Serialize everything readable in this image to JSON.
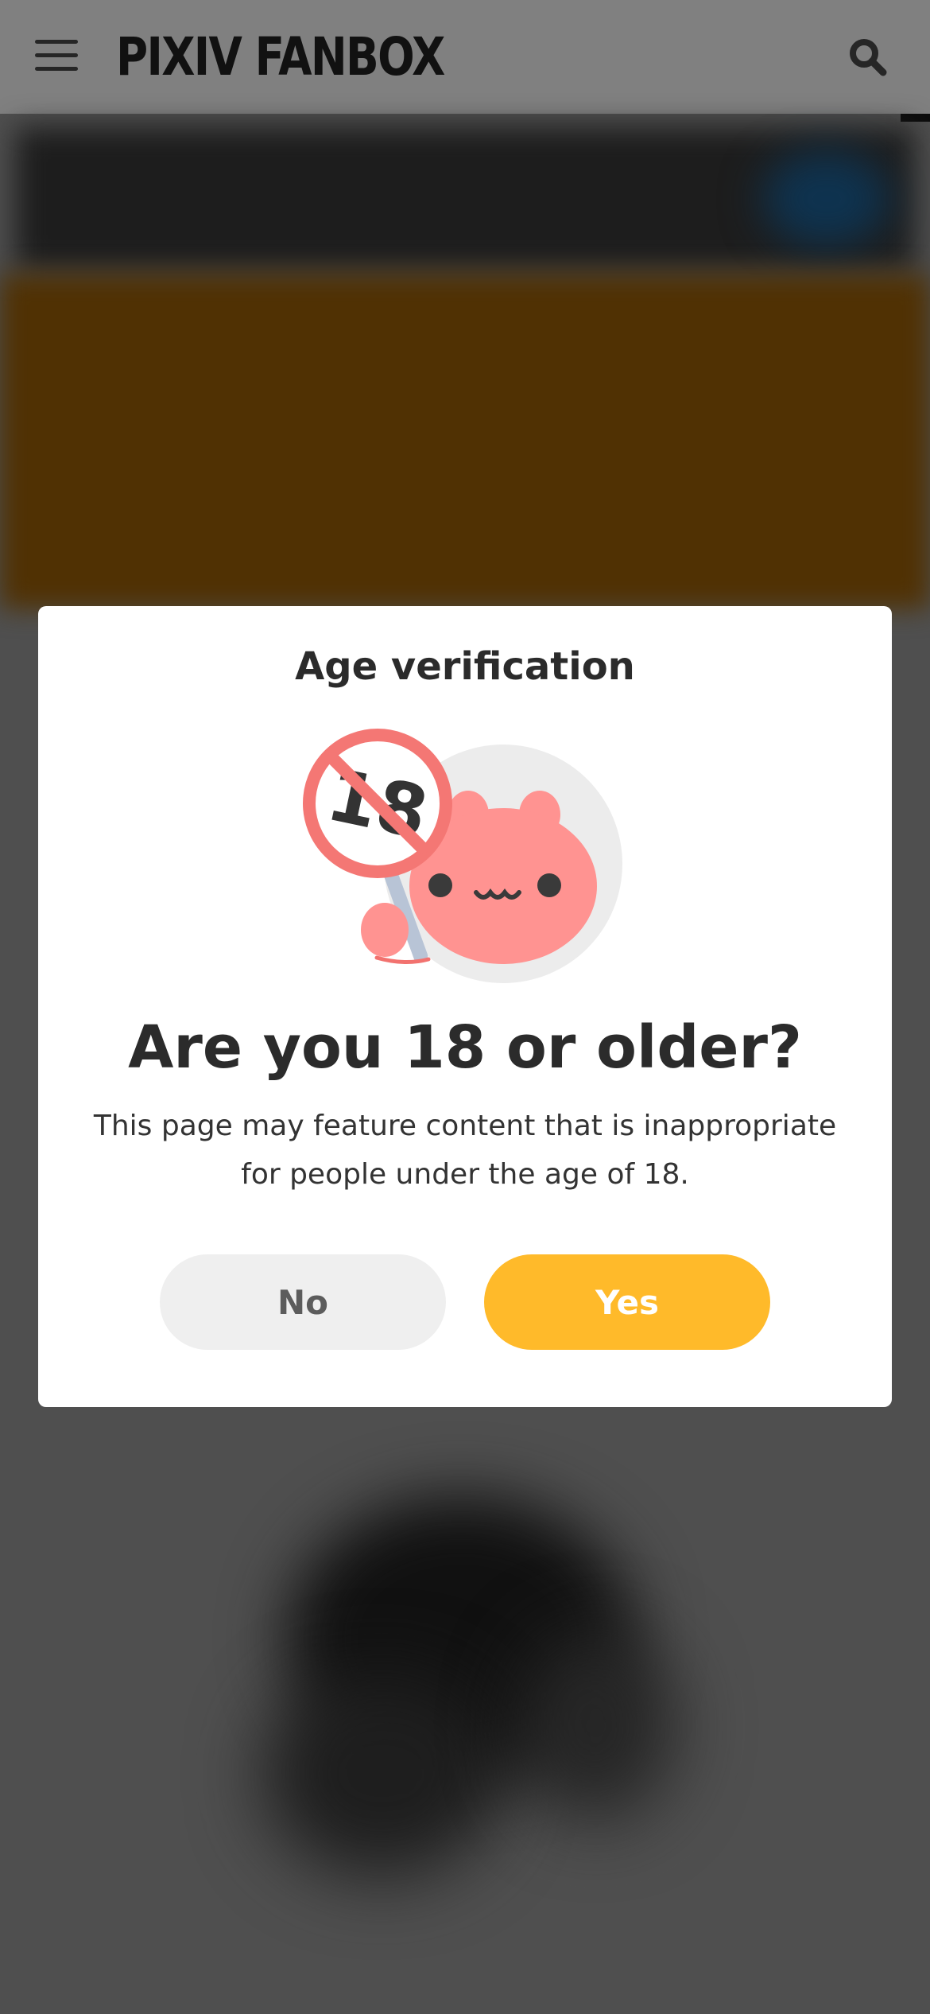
{
  "header": {
    "logo_text": "PIXIV FANBOX",
    "menu_icon": "hamburger-menu-icon",
    "search_icon": "search-icon",
    "background_color": "#808080"
  },
  "modal": {
    "title": "Age verification",
    "illustration_icon": "age-restriction-18-mascot-icon",
    "heading": "Are you 18 or older?",
    "description": "This page may feature content that is inappropriate for people under the age of 18.",
    "no_label": "No",
    "yes_label": "Yes"
  },
  "colors": {
    "accent_yellow": "#ffba2a",
    "no_button_bg": "#efefef",
    "overlay": "#4f4f4f",
    "text_dark": "#2b2b2b"
  }
}
